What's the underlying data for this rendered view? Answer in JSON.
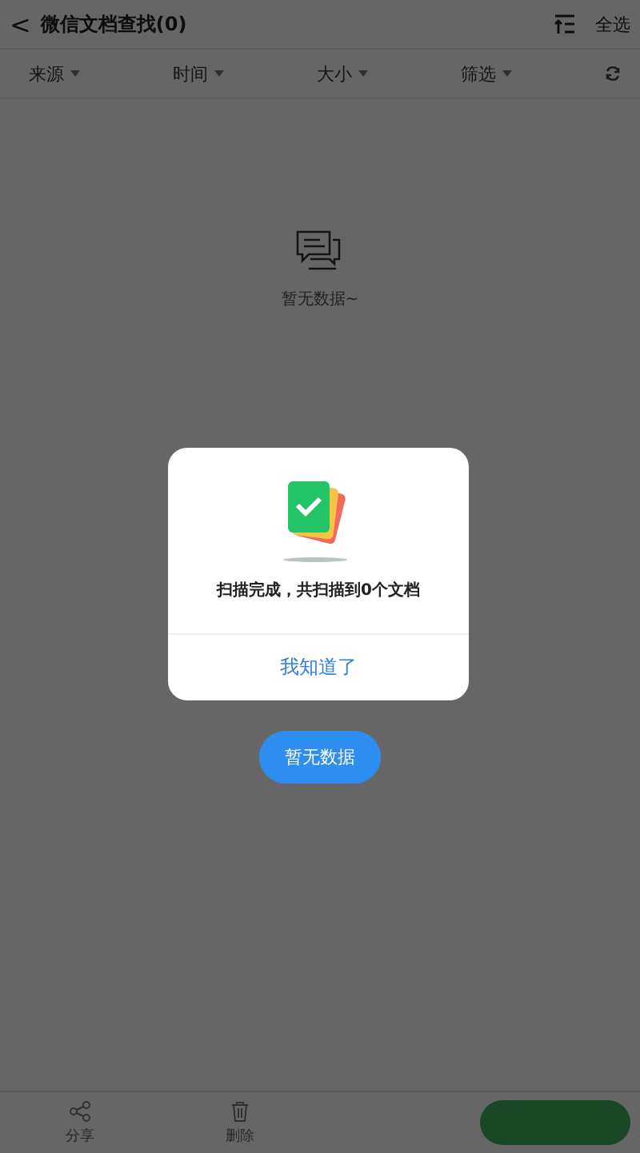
{
  "header": {
    "back": "<",
    "title": "微信文档查找(0)",
    "select_all": "全选"
  },
  "filters": [
    {
      "label": "来源"
    },
    {
      "label": "时间"
    },
    {
      "label": "大小"
    },
    {
      "label": "筛选"
    }
  ],
  "empty": {
    "text": "暂无数据~"
  },
  "dialog": {
    "message": "扫描完成，共扫描到0个文档",
    "confirm": "我知道了"
  },
  "floating_button": "暂无数据",
  "bottom_bar": {
    "actions": [
      {
        "label": "分享",
        "kind": "share"
      },
      {
        "label": "删除",
        "kind": "delete"
      }
    ]
  }
}
